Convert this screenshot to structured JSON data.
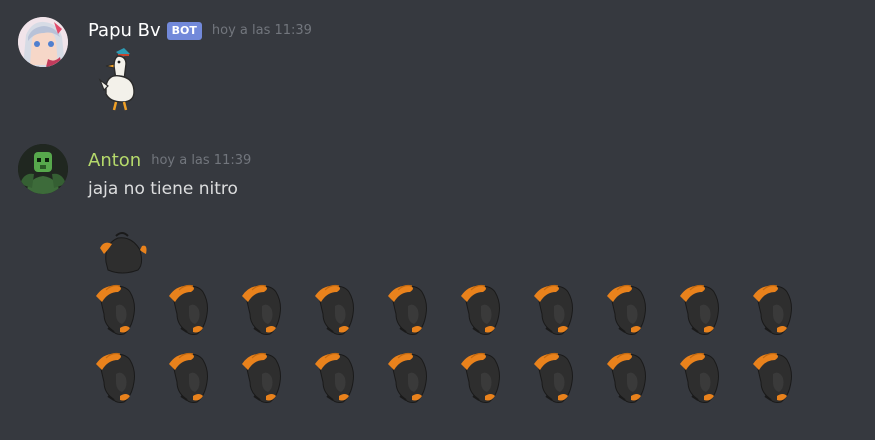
{
  "messages": [
    {
      "author": "Papu Bv",
      "author_color": "#ffffff",
      "bot_tag": "BOT",
      "bot_tag_color": "#7289da",
      "timestamp": "hoy a las 11:39",
      "avatar_icon": "anime-girl-avatar",
      "attachment": "goose-sticker"
    },
    {
      "author": "Anton",
      "author_color": "#b5d96b",
      "timestamp": "hoy a las 11:39",
      "avatar_icon": "green-hulk-avatar",
      "text": "jaja no tiene nitro",
      "emoji_name": "penguin-emoji",
      "emoji_count": 21,
      "emoji_rows": [
        1,
        10,
        10
      ]
    }
  ]
}
